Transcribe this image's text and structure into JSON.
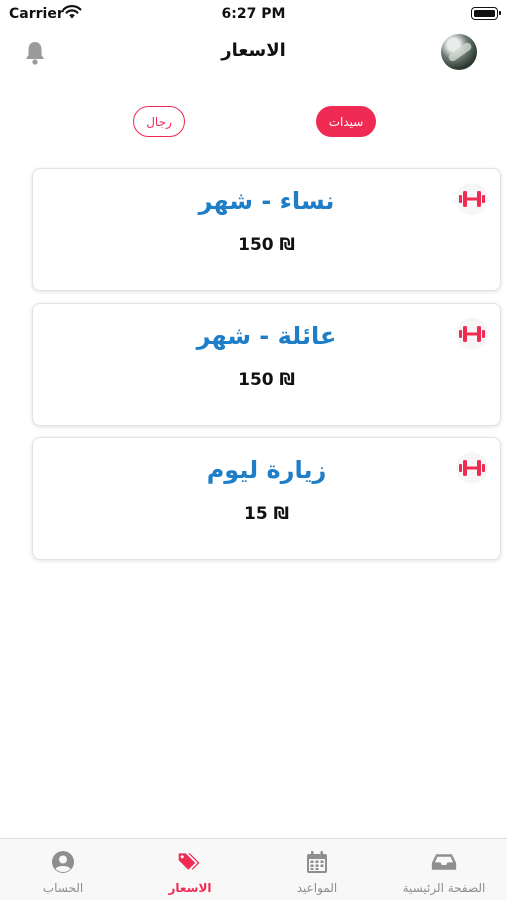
{
  "status_bar": {
    "carrier": "Carrier",
    "time": "6:27 PM"
  },
  "header": {
    "title": "الاسعار"
  },
  "gender_tabs": {
    "men": "رجال",
    "women": "سيدات",
    "selected": "women"
  },
  "colors": {
    "accent": "#ef2b53",
    "title_blue": "#1f7ec8",
    "inactive": "#8e8e8e"
  },
  "plans": [
    {
      "title": "نساء - شهر",
      "price": "150 ₪",
      "icon": "dumbbell-icon"
    },
    {
      "title": "عائلة - شهر",
      "price": "150 ₪",
      "icon": "dumbbell-icon"
    },
    {
      "title": "زيارة ليوم",
      "price": "15 ₪",
      "icon": "dumbbell-icon"
    }
  ],
  "tabbar": {
    "items": [
      {
        "label": "الحساب",
        "icon": "user-circle-icon",
        "active": false
      },
      {
        "label": "الاسعار",
        "icon": "tags-icon",
        "active": true
      },
      {
        "label": "المواعيد",
        "icon": "calendar-icon",
        "active": false
      },
      {
        "label": "الصفحة الرئيسية",
        "icon": "inbox-icon",
        "active": false
      }
    ]
  }
}
